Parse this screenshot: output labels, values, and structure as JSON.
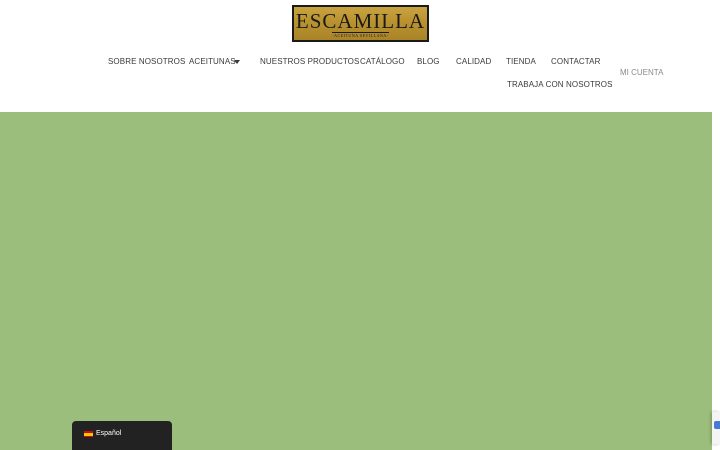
{
  "brand": {
    "logo_title": "ESCAMILLA",
    "logo_subtitle": "-ACEITUNA SEVILLANA-",
    "logo_color": "#b8912f"
  },
  "nav": {
    "items": [
      {
        "label": "SOBRE NOSOTROS"
      },
      {
        "label": "ACEITUNAS",
        "has_dropdown": true,
        "icon": "caret-down-icon"
      },
      {
        "label": "NUESTROS PRODUCTOS"
      },
      {
        "label": "CATÁLOGO"
      },
      {
        "label": "BLOG"
      },
      {
        "label": "CALIDAD"
      },
      {
        "label": "TIENDA"
      },
      {
        "label": "CONTACTAR"
      },
      {
        "label": "TRABAJA CON NOSOTROS"
      }
    ],
    "account_label": "MI CUENTA"
  },
  "hero": {
    "background_color": "#9bbe7c"
  },
  "language_switcher": {
    "label": "Español",
    "icon": "spain-flag-icon",
    "background_color": "#222222"
  },
  "recaptcha": {
    "icon": "recaptcha-icon"
  }
}
